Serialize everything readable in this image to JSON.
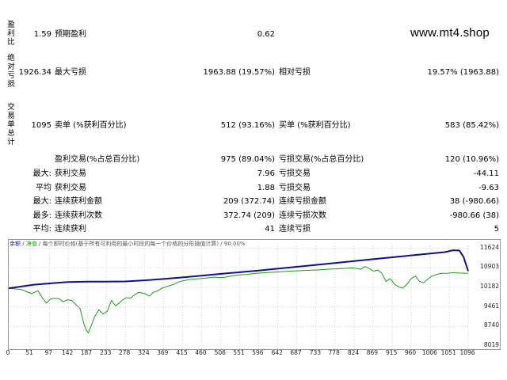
{
  "watermark": "www.mt4.shop",
  "side_labels": {
    "profit_factor": "盈\n利\n比",
    "absolute_drawdown": "绝\n对\n亏\n损",
    "total_trades": "交\n易\n单\n总\n计"
  },
  "stats": {
    "profit_factor": "1.59",
    "expected_payoff_label": "预期盈利",
    "expected_payoff": "0.62",
    "absolute_drawdown": "1926.34",
    "max_drawdown_label": "最大亏损",
    "max_drawdown": "1963.88 (19.57%)",
    "relative_drawdown_label": "相对亏损",
    "relative_drawdown": "19.57% (1963.88)",
    "total_trades": "1095",
    "short_label": "卖单 (%获利百分比)",
    "short_value": "512 (93.16%)",
    "long_label": "买单 (%获利百分比)",
    "long_value": "583 (85.42%)",
    "profit_trades_label": "盈利交易(%占总百分比)",
    "profit_trades_value": "975 (89.04%)",
    "loss_trades_label": "亏损交易(%占总百分比)",
    "loss_trades_value": "120 (10.96%)"
  },
  "rows": [
    {
      "prefix": "最大:",
      "l1": "获利交易",
      "v1": "7.96",
      "l2": "亏损交易",
      "v2": "-44.11"
    },
    {
      "prefix": "平均",
      "l1": "获利交易",
      "v1": "1.88",
      "l2": "亏损交易",
      "v2": "-9.63"
    },
    {
      "prefix": "最大:",
      "l1": "连续获利金额",
      "v1": "209 (372.74)",
      "l2": "连续亏损金额",
      "v2": "38 (-980.66)"
    },
    {
      "prefix": "最多:",
      "l1": "连续获利次数",
      "v1": "372.74 (209)",
      "l2": "连续亏损次数",
      "v2": "-980.66 (38)"
    },
    {
      "prefix": "平均:",
      "l1": "连续获利",
      "v1": "41",
      "l2": "连续亏损",
      "v2": "5"
    }
  ],
  "chart_legend": {
    "balance": "余额",
    "sep1": " / ",
    "equity": "净值",
    "rest": " / 每个即时价格(基于所有可利用的最小时段的每一个价格的分形插值计算) / 90.00%"
  },
  "chart_data": {
    "type": "line",
    "x_ticks": [
      "0",
      "51",
      "97",
      "142",
      "187",
      "233",
      "278",
      "324",
      "369",
      "415",
      "460",
      "506",
      "551",
      "596",
      "642",
      "687",
      "733",
      "778",
      "824",
      "869",
      "915",
      "960",
      "1006",
      "1051",
      "1096"
    ],
    "y_ticks": [
      "11624",
      "10903",
      "10182",
      "9461",
      "8740",
      "8019"
    ],
    "xlim": [
      0,
      1096
    ],
    "ylim": [
      8019,
      11700
    ],
    "colors": {
      "balance": "#10108c",
      "equity": "#13a013",
      "grid": "#d0d0d0"
    },
    "series": [
      {
        "name": "余额",
        "x": [
          0,
          60,
          100,
          142,
          187,
          233,
          278,
          324,
          369,
          415,
          460,
          506,
          551,
          596,
          642,
          687,
          733,
          778,
          824,
          869,
          915,
          960,
          1006,
          1040,
          1060,
          1075,
          1085,
          1096
        ],
        "y": [
          10150,
          10280,
          10330,
          10380,
          10390,
          10390,
          10400,
          10440,
          10490,
          10550,
          10610,
          10680,
          10740,
          10800,
          10870,
          10940,
          11010,
          11080,
          11150,
          11220,
          11290,
          11360,
          11430,
          11480,
          11550,
          11540,
          11300,
          10780
        ]
      },
      {
        "name": "净值",
        "x": [
          0,
          30,
          55,
          70,
          80,
          90,
          100,
          110,
          120,
          130,
          140,
          150,
          160,
          170,
          180,
          185,
          190,
          195,
          205,
          215,
          225,
          235,
          245,
          255,
          265,
          270,
          280,
          290,
          300,
          310,
          325,
          335,
          345,
          355,
          365,
          375,
          385,
          395,
          405,
          415,
          425,
          435,
          450,
          470,
          490,
          510,
          530,
          550,
          570,
          590,
          610,
          630,
          650,
          670,
          700,
          730,
          760,
          790,
          820,
          840,
          850,
          860,
          870,
          880,
          890,
          900,
          910,
          920,
          930,
          940,
          950,
          960,
          970,
          980,
          990,
          1000,
          1010,
          1020,
          1030,
          1045,
          1060,
          1075,
          1096
        ],
        "y": [
          10150,
          10100,
          9950,
          10060,
          9800,
          9600,
          9750,
          9780,
          9760,
          9650,
          9720,
          9700,
          9550,
          9400,
          8800,
          8600,
          8500,
          8700,
          9100,
          9350,
          9200,
          9300,
          9700,
          9500,
          9620,
          9700,
          9800,
          9780,
          9900,
          10000,
          9950,
          9860,
          10000,
          10050,
          10150,
          10200,
          10250,
          10300,
          10380,
          10420,
          10450,
          10480,
          10500,
          10520,
          10560,
          10540,
          10600,
          10640,
          10660,
          10700,
          10720,
          10740,
          10760,
          10780,
          10800,
          10820,
          10850,
          10870,
          10900,
          10850,
          10950,
          10880,
          10780,
          10820,
          10700,
          10400,
          10500,
          10300,
          10200,
          10150,
          10300,
          10500,
          10600,
          10400,
          10350,
          10500,
          10600,
          10650,
          10700,
          10700,
          10720,
          10710,
          10700
        ]
      }
    ]
  }
}
